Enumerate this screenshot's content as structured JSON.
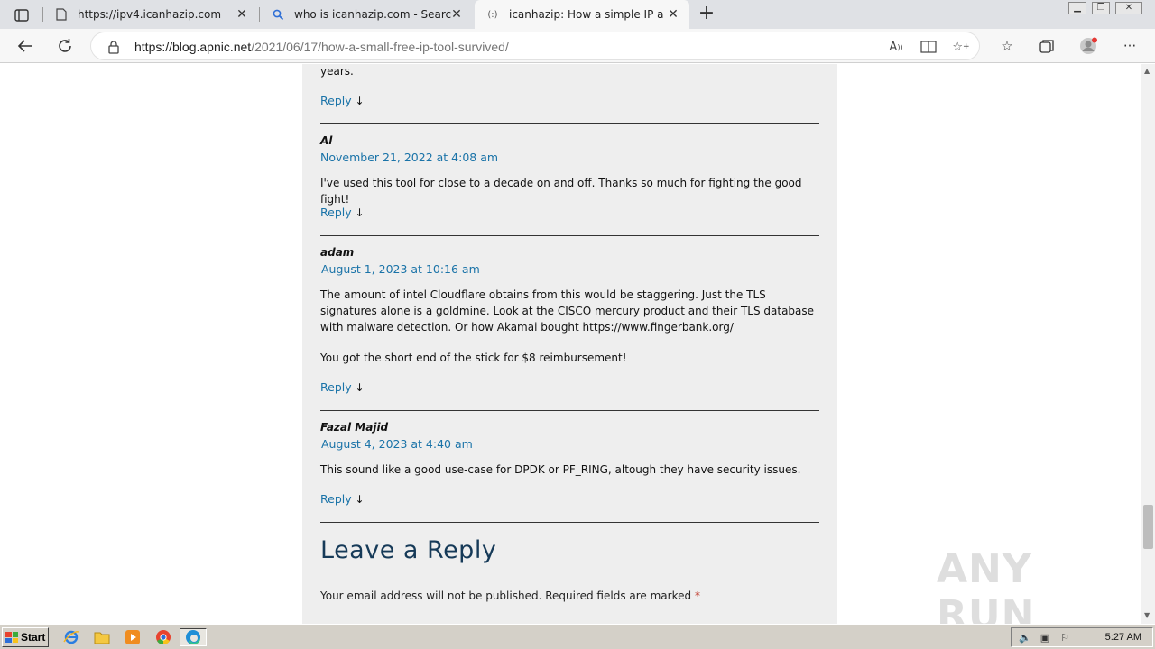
{
  "browser": {
    "tabs": [
      {
        "title": "https://ipv4.icanhazip.com",
        "icon": "page-icon"
      },
      {
        "title": "who is icanhazip.com - Search",
        "icon": "search-icon"
      },
      {
        "title": "icanhazip: How a simple IP addre",
        "icon": "site-favicon"
      }
    ],
    "new_tab_label": "+",
    "url_host": "https://blog.apnic.net",
    "url_path": "/2021/06/17/how-a-small-free-ip-tool-survived/"
  },
  "page": {
    "prev_tail": "years.",
    "reply_label": "Reply",
    "reply_arrow": "↓",
    "comments": [
      {
        "author": "Al",
        "date": "November 21, 2022 at 4:08 am",
        "paragraphs": [
          "I've used this tool for close to a decade on and off. Thanks so much for fighting the good fight!"
        ]
      },
      {
        "author": "adam",
        "date": "August 1, 2023 at 10:16 am",
        "paragraphs": [
          "The amount of intel Cloudflare obtains from this would be staggering. Just the TLS signatures alone is a goldmine. Look at the CISCO mercury product and their TLS database with malware detection. Or how Akamai bought https://www.fingerbank.org/",
          "You got the short end of the stick for $8 reimbursement!"
        ]
      },
      {
        "author": "Fazal Majid",
        "date": "August 4, 2023 at 4:40 am",
        "paragraphs": [
          "This sound like a good use-case for DPDK or PF_RING, altough they have security issues."
        ]
      }
    ],
    "leave_reply_heading": "Leave a Reply",
    "email_note": "Your email address will not be published. Required fields are marked",
    "required_mark": "*"
  },
  "watermark": "ANY RUN",
  "taskbar": {
    "start_label": "Start",
    "clock": "5:27 AM"
  },
  "colors": {
    "link": "#1a73a8",
    "heading": "#163a58",
    "panel_bg": "#eeeeee",
    "required": "#c0392b"
  }
}
